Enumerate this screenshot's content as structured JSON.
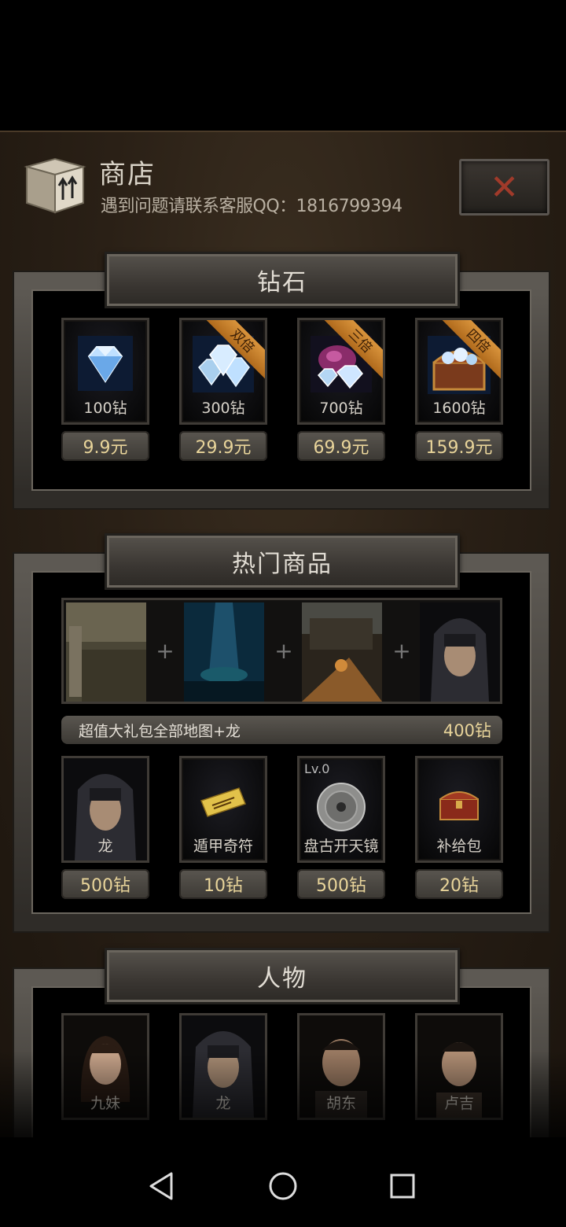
{
  "header": {
    "title": "商店",
    "subtitle": "遇到问题请联系客服QQ：1816799394",
    "close_glyph": "✕",
    "icon": "package-box-icon"
  },
  "diamonds": {
    "title": "钻石",
    "items": [
      {
        "label": "100钻",
        "price": "9.9元",
        "badge": "",
        "icon": "diamond-icon"
      },
      {
        "label": "300钻",
        "price": "29.9元",
        "badge": "双倍",
        "icon": "diamond-pile-icon"
      },
      {
        "label": "700钻",
        "price": "69.9元",
        "badge": "三倍",
        "icon": "diamond-bag-icon"
      },
      {
        "label": "1600钻",
        "price": "159.9元",
        "badge": "四倍",
        "icon": "treasure-chest-icon"
      }
    ]
  },
  "hot": {
    "title": "热门商品",
    "combo_plus": "+",
    "bundle_name": "超值大礼包全部地图+龙",
    "bundle_price": "400钻",
    "items": [
      {
        "label": "龙",
        "price": "500钻",
        "icon": "hooded-man-portrait"
      },
      {
        "label": "遁甲奇符",
        "price": "10钻",
        "icon": "talisman-icon"
      },
      {
        "label": "盘古开天镜",
        "price": "500钻",
        "icon": "bronze-mirror-icon",
        "level": "Lv.0"
      },
      {
        "label": "补给包",
        "price": "20钻",
        "icon": "chest-icon"
      }
    ]
  },
  "characters": {
    "title": "人物",
    "items": [
      {
        "label": "九妹"
      },
      {
        "label": "龙"
      },
      {
        "label": "胡东"
      },
      {
        "label": "卢吉"
      }
    ]
  }
}
